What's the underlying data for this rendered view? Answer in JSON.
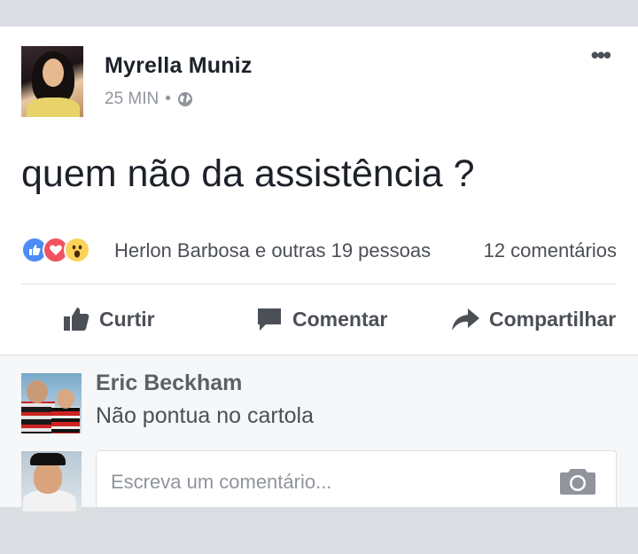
{
  "post": {
    "author": "Myrella Muniz",
    "time": "25 MIN",
    "separator": "•",
    "privacy_icon": "globe-icon",
    "more_icon": "•••",
    "text": "quem não da assistência ?",
    "reactions": {
      "icons": [
        "like-icon",
        "love-icon",
        "wow-icon"
      ],
      "names": "Herlon Barbosa e outras 19 pessoas",
      "comments": "12 comentários"
    },
    "actions": {
      "like": "Curtir",
      "comment": "Comentar",
      "share": "Compartilhar"
    }
  },
  "comments": [
    {
      "author": "Eric Beckham",
      "text": "Não pontua no cartola"
    }
  ],
  "composer": {
    "placeholder": "Escreva um comentário..."
  },
  "colors": {
    "like": "#4d8cf5",
    "love": "#f0525f",
    "wow": "#fcd25b",
    "text": "#1d2129",
    "secondary": "#90949c"
  }
}
